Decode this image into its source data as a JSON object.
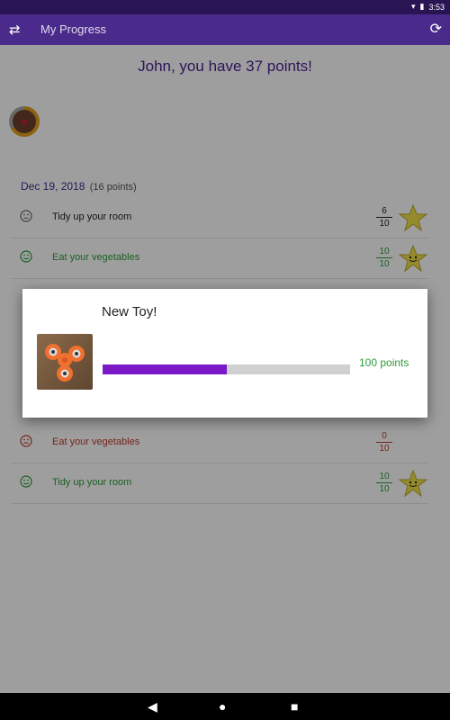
{
  "status_bar": {
    "time": "3:53"
  },
  "app_bar": {
    "title": "My Progress",
    "swap_icon": "swap-icon",
    "refresh_icon": "refresh-icon"
  },
  "main": {
    "points_title": "John, you have 37 points!",
    "date": "Dec 19, 2018",
    "date_points": "(16 points)"
  },
  "tasks": [
    {
      "name": "Tidy up your room",
      "score": "6",
      "total": "10",
      "status": "neutral"
    },
    {
      "name": "Eat your vegetables",
      "score": "10",
      "total": "10",
      "status": "happy"
    },
    {
      "name": "Eat your vegetables",
      "score": "0",
      "total": "10",
      "status": "sad"
    },
    {
      "name": "Tidy up your room",
      "score": "10",
      "total": "10",
      "status": "happy"
    }
  ],
  "dialog": {
    "title": "New Toy!",
    "points_label": "100 points",
    "progress_fraction": 0.5
  },
  "colors": {
    "accent": "#4a2a8a",
    "success": "#2e9b3a",
    "error": "#c0392b",
    "progress": "#7b18c8",
    "star": "#f0e04a"
  }
}
